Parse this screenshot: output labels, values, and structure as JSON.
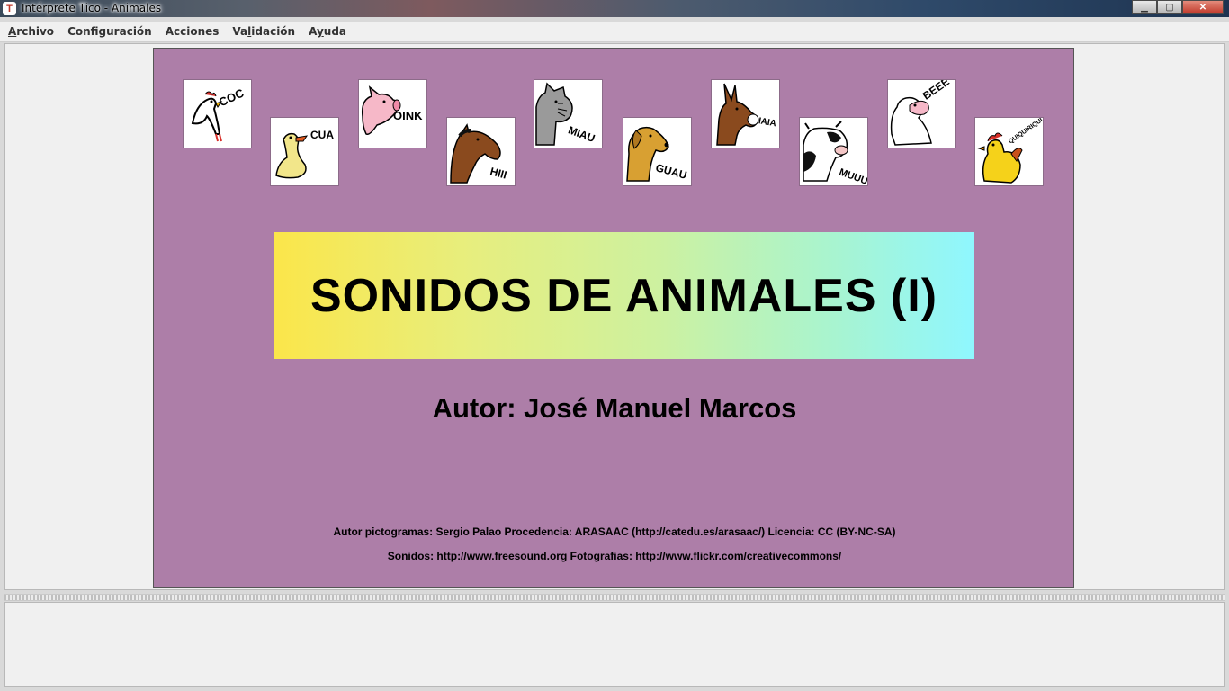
{
  "window": {
    "title": "Intérprete Tico - Animales",
    "app_icon": "tico-icon"
  },
  "menu": [
    {
      "label_pre": "",
      "label_ul": "A",
      "label_post": "rchivo"
    },
    {
      "label_pre": "Configuración",
      "label_ul": "",
      "label_post": ""
    },
    {
      "label_pre": "Acciones",
      "label_ul": "",
      "label_post": ""
    },
    {
      "label_pre": "Va",
      "label_ul": "l",
      "label_post": "idación"
    },
    {
      "label_pre": "A",
      "label_ul": "y",
      "label_post": "uda"
    }
  ],
  "board": {
    "background": "#ad7ea8",
    "title": "SONIDOS DE ANIMALES (I)",
    "author": "Autor: José Manuel Marcos",
    "credits_line1": "Autor pictogramas: Sergio Palao Procedencia: ARASAAC (http://catedu.es/arasaac/) Licencia: CC (BY-NC-SA)",
    "credits_line2": "Sonidos: http://www.freesound.org Fotografias: http://www.flickr.com/creativecommons/"
  },
  "animals": [
    {
      "animal": "hen",
      "sound": "COC"
    },
    {
      "animal": "duck",
      "sound": "CUA"
    },
    {
      "animal": "pig",
      "sound": "OINK"
    },
    {
      "animal": "horse",
      "sound": "HIII"
    },
    {
      "animal": "cat",
      "sound": "MIAU"
    },
    {
      "animal": "dog",
      "sound": "GUAU"
    },
    {
      "animal": "donkey",
      "sound": "IAIA"
    },
    {
      "animal": "cow",
      "sound": "MUUU"
    },
    {
      "animal": "sheep",
      "sound": "BEEE"
    },
    {
      "animal": "rooster",
      "sound": "QUIQUIRIQUI"
    }
  ]
}
